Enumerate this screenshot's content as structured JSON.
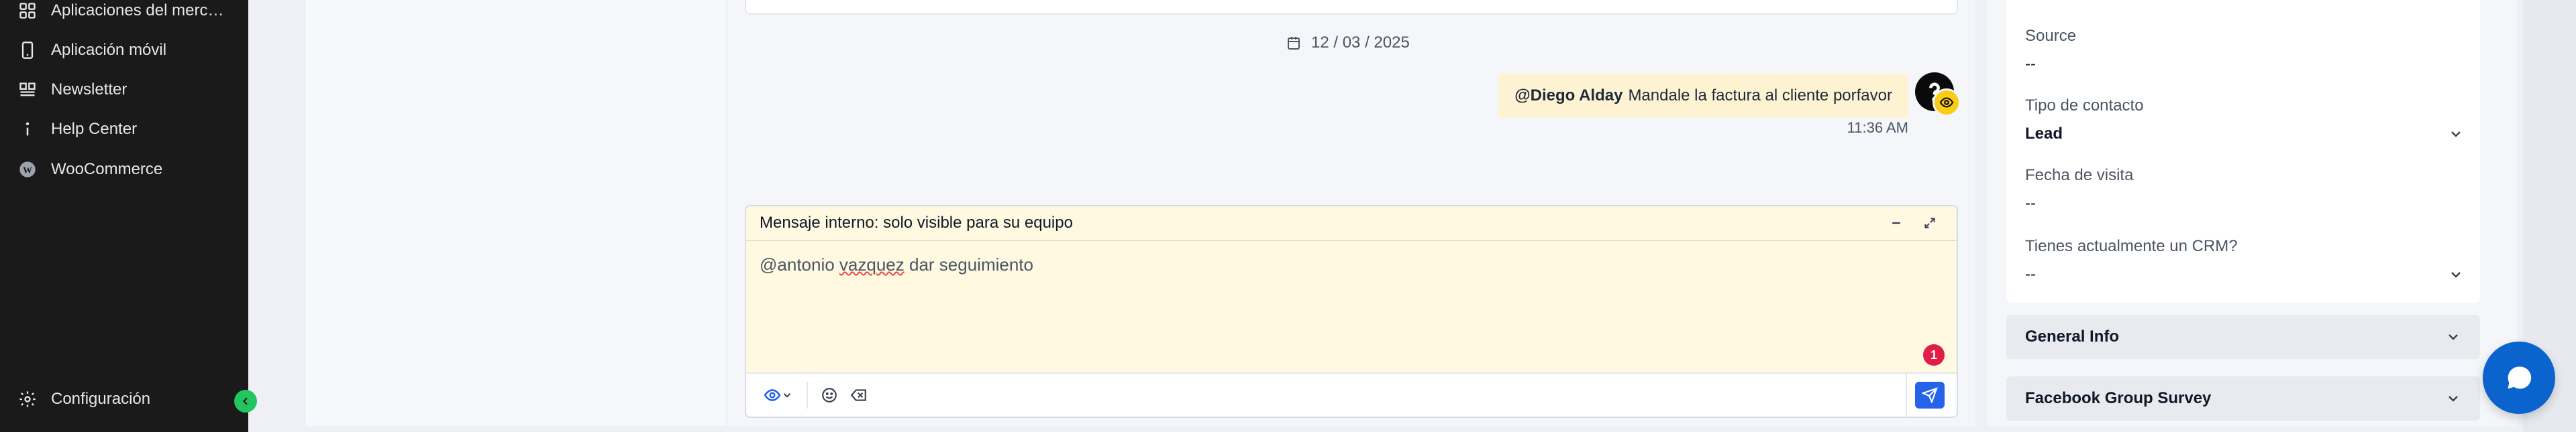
{
  "sidebar": {
    "items": [
      {
        "label": "Aplicaciones del merc…",
        "icon": "grid-icon"
      },
      {
        "label": "Aplicación móvil",
        "icon": "mobile-icon"
      },
      {
        "label": "Newsletter",
        "icon": "newsletter-icon"
      },
      {
        "label": "Help Center",
        "icon": "info-icon"
      },
      {
        "label": "WooCommerce",
        "icon": "wordpress-icon"
      }
    ],
    "settings_label": "Configuración"
  },
  "conversation": {
    "date": "12 / 03 / 2025",
    "note": {
      "mention": "@Diego Alday",
      "text": "Mandale la factura al cliente porfavor",
      "time": "11:36 AM"
    }
  },
  "composer": {
    "header": "Mensaje interno: solo visible para su equipo",
    "text_prefix": "@antonio ",
    "text_misspelled": "vazquez",
    "text_suffix": " dar seguimiento",
    "badge_count": "1"
  },
  "details": {
    "fields": [
      {
        "label": "Source",
        "value": "--"
      },
      {
        "label": "Tipo de contacto",
        "value": "Lead"
      },
      {
        "label": "Fecha de visita",
        "value": "--"
      },
      {
        "label": "Tienes actualmente un CRM?",
        "value": "--"
      }
    ],
    "sections": [
      "General Info",
      "Facebook Group Survey"
    ]
  },
  "colors": {
    "sidebar_bg": "#1a1a1a",
    "note_bg": "#fdf3d3",
    "composer_bg": "#fef9e0",
    "accent": "#2563eb",
    "launcher": "#0b63ce",
    "badge": "#e11d48"
  }
}
